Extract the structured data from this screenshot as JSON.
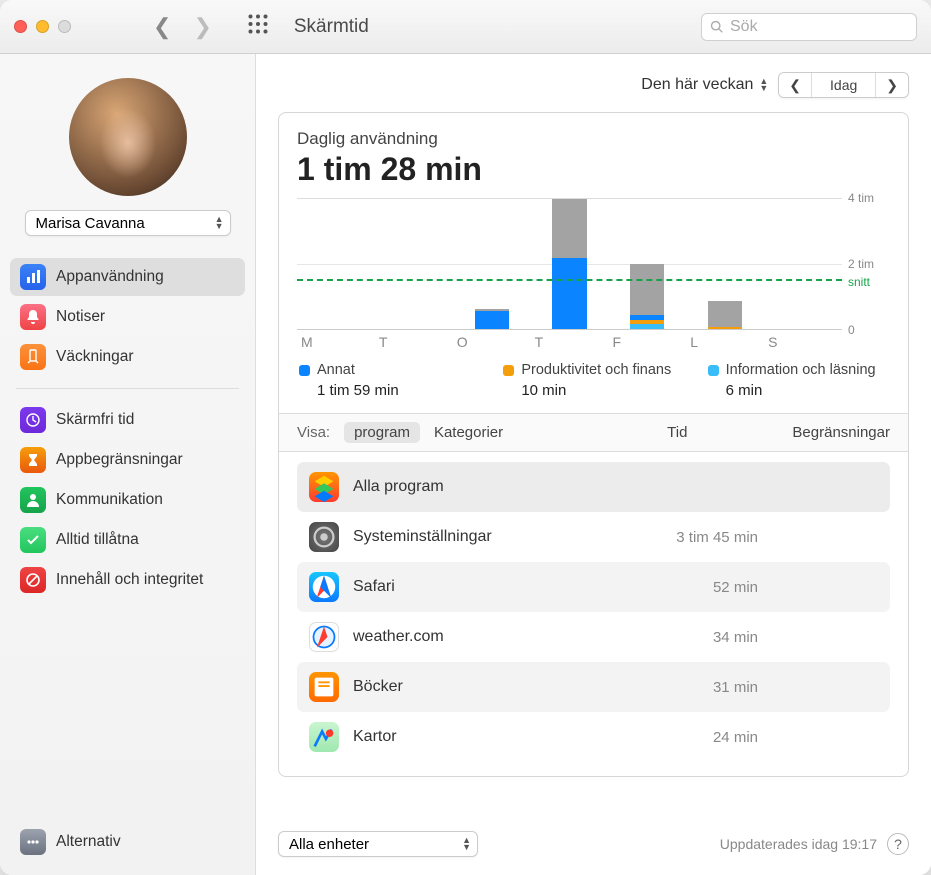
{
  "window": {
    "title": "Skärmtid",
    "search_placeholder": "Sök"
  },
  "user": {
    "name": "Marisa Cavanna"
  },
  "sidebar": {
    "items": [
      {
        "label": "Appanvändning"
      },
      {
        "label": "Notiser"
      },
      {
        "label": "Väckningar"
      },
      {
        "label": "Skärmfri tid"
      },
      {
        "label": "Appbegränsningar"
      },
      {
        "label": "Kommunikation"
      },
      {
        "label": "Alltid tillåtna"
      },
      {
        "label": "Innehåll och integritet"
      }
    ],
    "options_label": "Alternativ"
  },
  "topbar": {
    "period_label": "Den här veckan",
    "today_label": "Idag"
  },
  "usage": {
    "title": "Daglig användning",
    "total": "1 tim 28 min"
  },
  "chart_data": {
    "type": "bar",
    "categories": [
      "M",
      "T",
      "O",
      "T",
      "F",
      "L",
      "S"
    ],
    "ylabel": "",
    "y_ticks": [
      "4 tim",
      "2 tim",
      "0"
    ],
    "ylim": [
      0,
      4
    ],
    "avg_label": "snitt",
    "avg_value": 1.47,
    "series_stacked": [
      {
        "day": "M",
        "segments": []
      },
      {
        "day": "T",
        "segments": []
      },
      {
        "day": "O",
        "segments": [
          {
            "cat": "blue",
            "h": 0.55
          },
          {
            "cat": "other",
            "h": 0.06
          }
        ]
      },
      {
        "day": "T",
        "segments": [
          {
            "cat": "blue",
            "h": 2.15
          },
          {
            "cat": "other",
            "h": 1.8
          }
        ]
      },
      {
        "day": "F",
        "segments": [
          {
            "cat": "info",
            "h": 0.15
          },
          {
            "cat": "prod",
            "h": 0.12
          },
          {
            "cat": "blue",
            "h": 0.15
          },
          {
            "cat": "other",
            "h": 1.55
          }
        ]
      },
      {
        "day": "L",
        "segments": [
          {
            "cat": "prod",
            "h": 0.06
          },
          {
            "cat": "other",
            "h": 0.78
          }
        ]
      },
      {
        "day": "S",
        "segments": []
      }
    ]
  },
  "legend": [
    {
      "color": "#0a84ff",
      "label": "Annat",
      "time": "1 tim 59 min"
    },
    {
      "color": "#f59e0b",
      "label": "Produktivitet och finans",
      "time": "10 min"
    },
    {
      "color": "#38bdf8",
      "label": "Information och läsning",
      "time": "6 min"
    }
  ],
  "filterbar": {
    "show_label": "Visa:",
    "program": "program",
    "categories": "Kategorier",
    "time": "Tid",
    "limits": "Begränsningar"
  },
  "apps": {
    "header": "Alla program",
    "rows": [
      {
        "name": "Systeminställningar",
        "time": "3 tim 45 min"
      },
      {
        "name": "Safari",
        "time": "52 min"
      },
      {
        "name": "weather.com",
        "time": "34 min"
      },
      {
        "name": "Böcker",
        "time": "31 min"
      },
      {
        "name": "Kartor",
        "time": "24 min"
      }
    ]
  },
  "bottom": {
    "devices": "Alla enheter",
    "updated": "Uppdaterades idag 19:17",
    "help": "?"
  }
}
